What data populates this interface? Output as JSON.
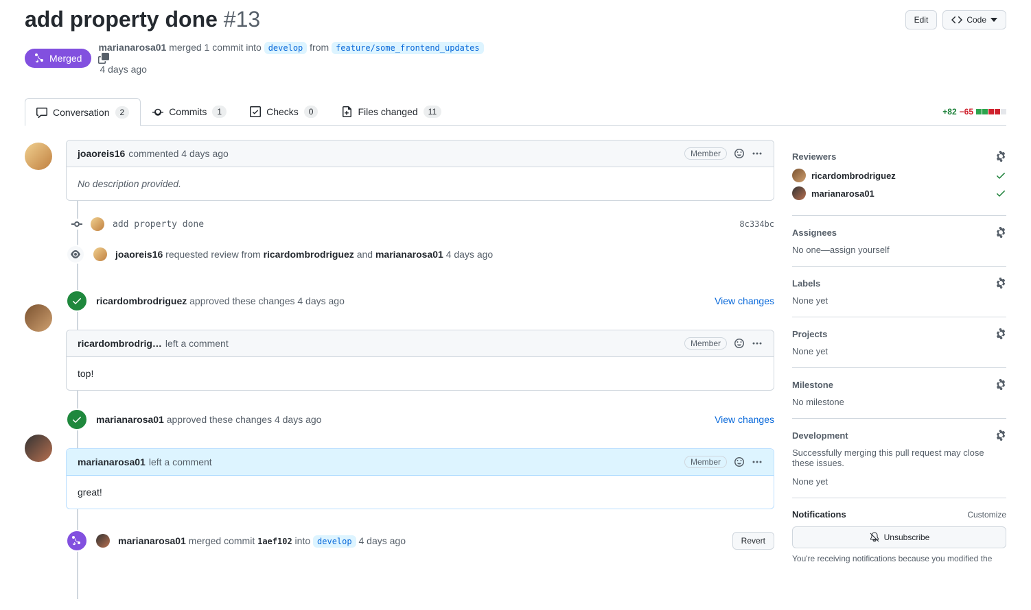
{
  "header": {
    "title": "add property done",
    "number": "#13",
    "edit": "Edit",
    "code": "Code"
  },
  "state": {
    "label": "Merged"
  },
  "meta": {
    "author": "marianarosa01",
    "action": "merged 1 commit into",
    "base": "develop",
    "from": "from",
    "head": "feature/some_frontend_updates",
    "time": "4 days ago"
  },
  "tabs": {
    "conversation": {
      "label": "Conversation",
      "count": "2"
    },
    "commits": {
      "label": "Commits",
      "count": "1"
    },
    "checks": {
      "label": "Checks",
      "count": "0"
    },
    "files": {
      "label": "Files changed",
      "count": "11"
    }
  },
  "diffstat": {
    "add": "+82",
    "del": "−65"
  },
  "timeline": {
    "comment1": {
      "user": "joaoreis16",
      "meta": "commented 4 days ago",
      "role": "Member",
      "body": "No description provided."
    },
    "commit": {
      "msg": "add property done",
      "sha": "8c334bc"
    },
    "reqreview": {
      "actor": "joaoreis16",
      "text1": " requested review from ",
      "r1": "ricardombrodriguez",
      "and": " and ",
      "r2": "marianarosa01",
      "time": "4 days ago"
    },
    "approve1": {
      "user": "ricardombrodriguez",
      "meta": "approved these changes 4 days ago",
      "viewchanges": "View changes"
    },
    "comment2": {
      "user": "ricardombrodrig…",
      "meta": "left a comment",
      "role": "Member",
      "body": "top!"
    },
    "approve2": {
      "user": "marianarosa01",
      "meta": "approved these changes 4 days ago",
      "viewchanges": "View changes"
    },
    "comment3": {
      "user": "marianarosa01",
      "meta": "left a comment",
      "role": "Member",
      "body": "great!"
    },
    "merge": {
      "user": "marianarosa01",
      "text1": " merged commit ",
      "sha": "1aef102",
      "into": " into ",
      "branch": "develop",
      "time": "4 days ago",
      "revert": "Revert"
    }
  },
  "sidebar": {
    "reviewers": {
      "title": "Reviewers",
      "items": [
        {
          "name": "ricardombrodriguez"
        },
        {
          "name": "marianarosa01"
        }
      ]
    },
    "assignees": {
      "title": "Assignees",
      "none": "No one—",
      "assign": "assign yourself"
    },
    "labels": {
      "title": "Labels",
      "none": "None yet"
    },
    "projects": {
      "title": "Projects",
      "none": "None yet"
    },
    "milestone": {
      "title": "Milestone",
      "none": "No milestone"
    },
    "development": {
      "title": "Development",
      "desc": "Successfully merging this pull request may close these issues.",
      "none": "None yet"
    },
    "notifications": {
      "title": "Notifications",
      "customize": "Customize",
      "unsub": "Unsubscribe",
      "desc": "You're receiving notifications because you modified the"
    }
  }
}
